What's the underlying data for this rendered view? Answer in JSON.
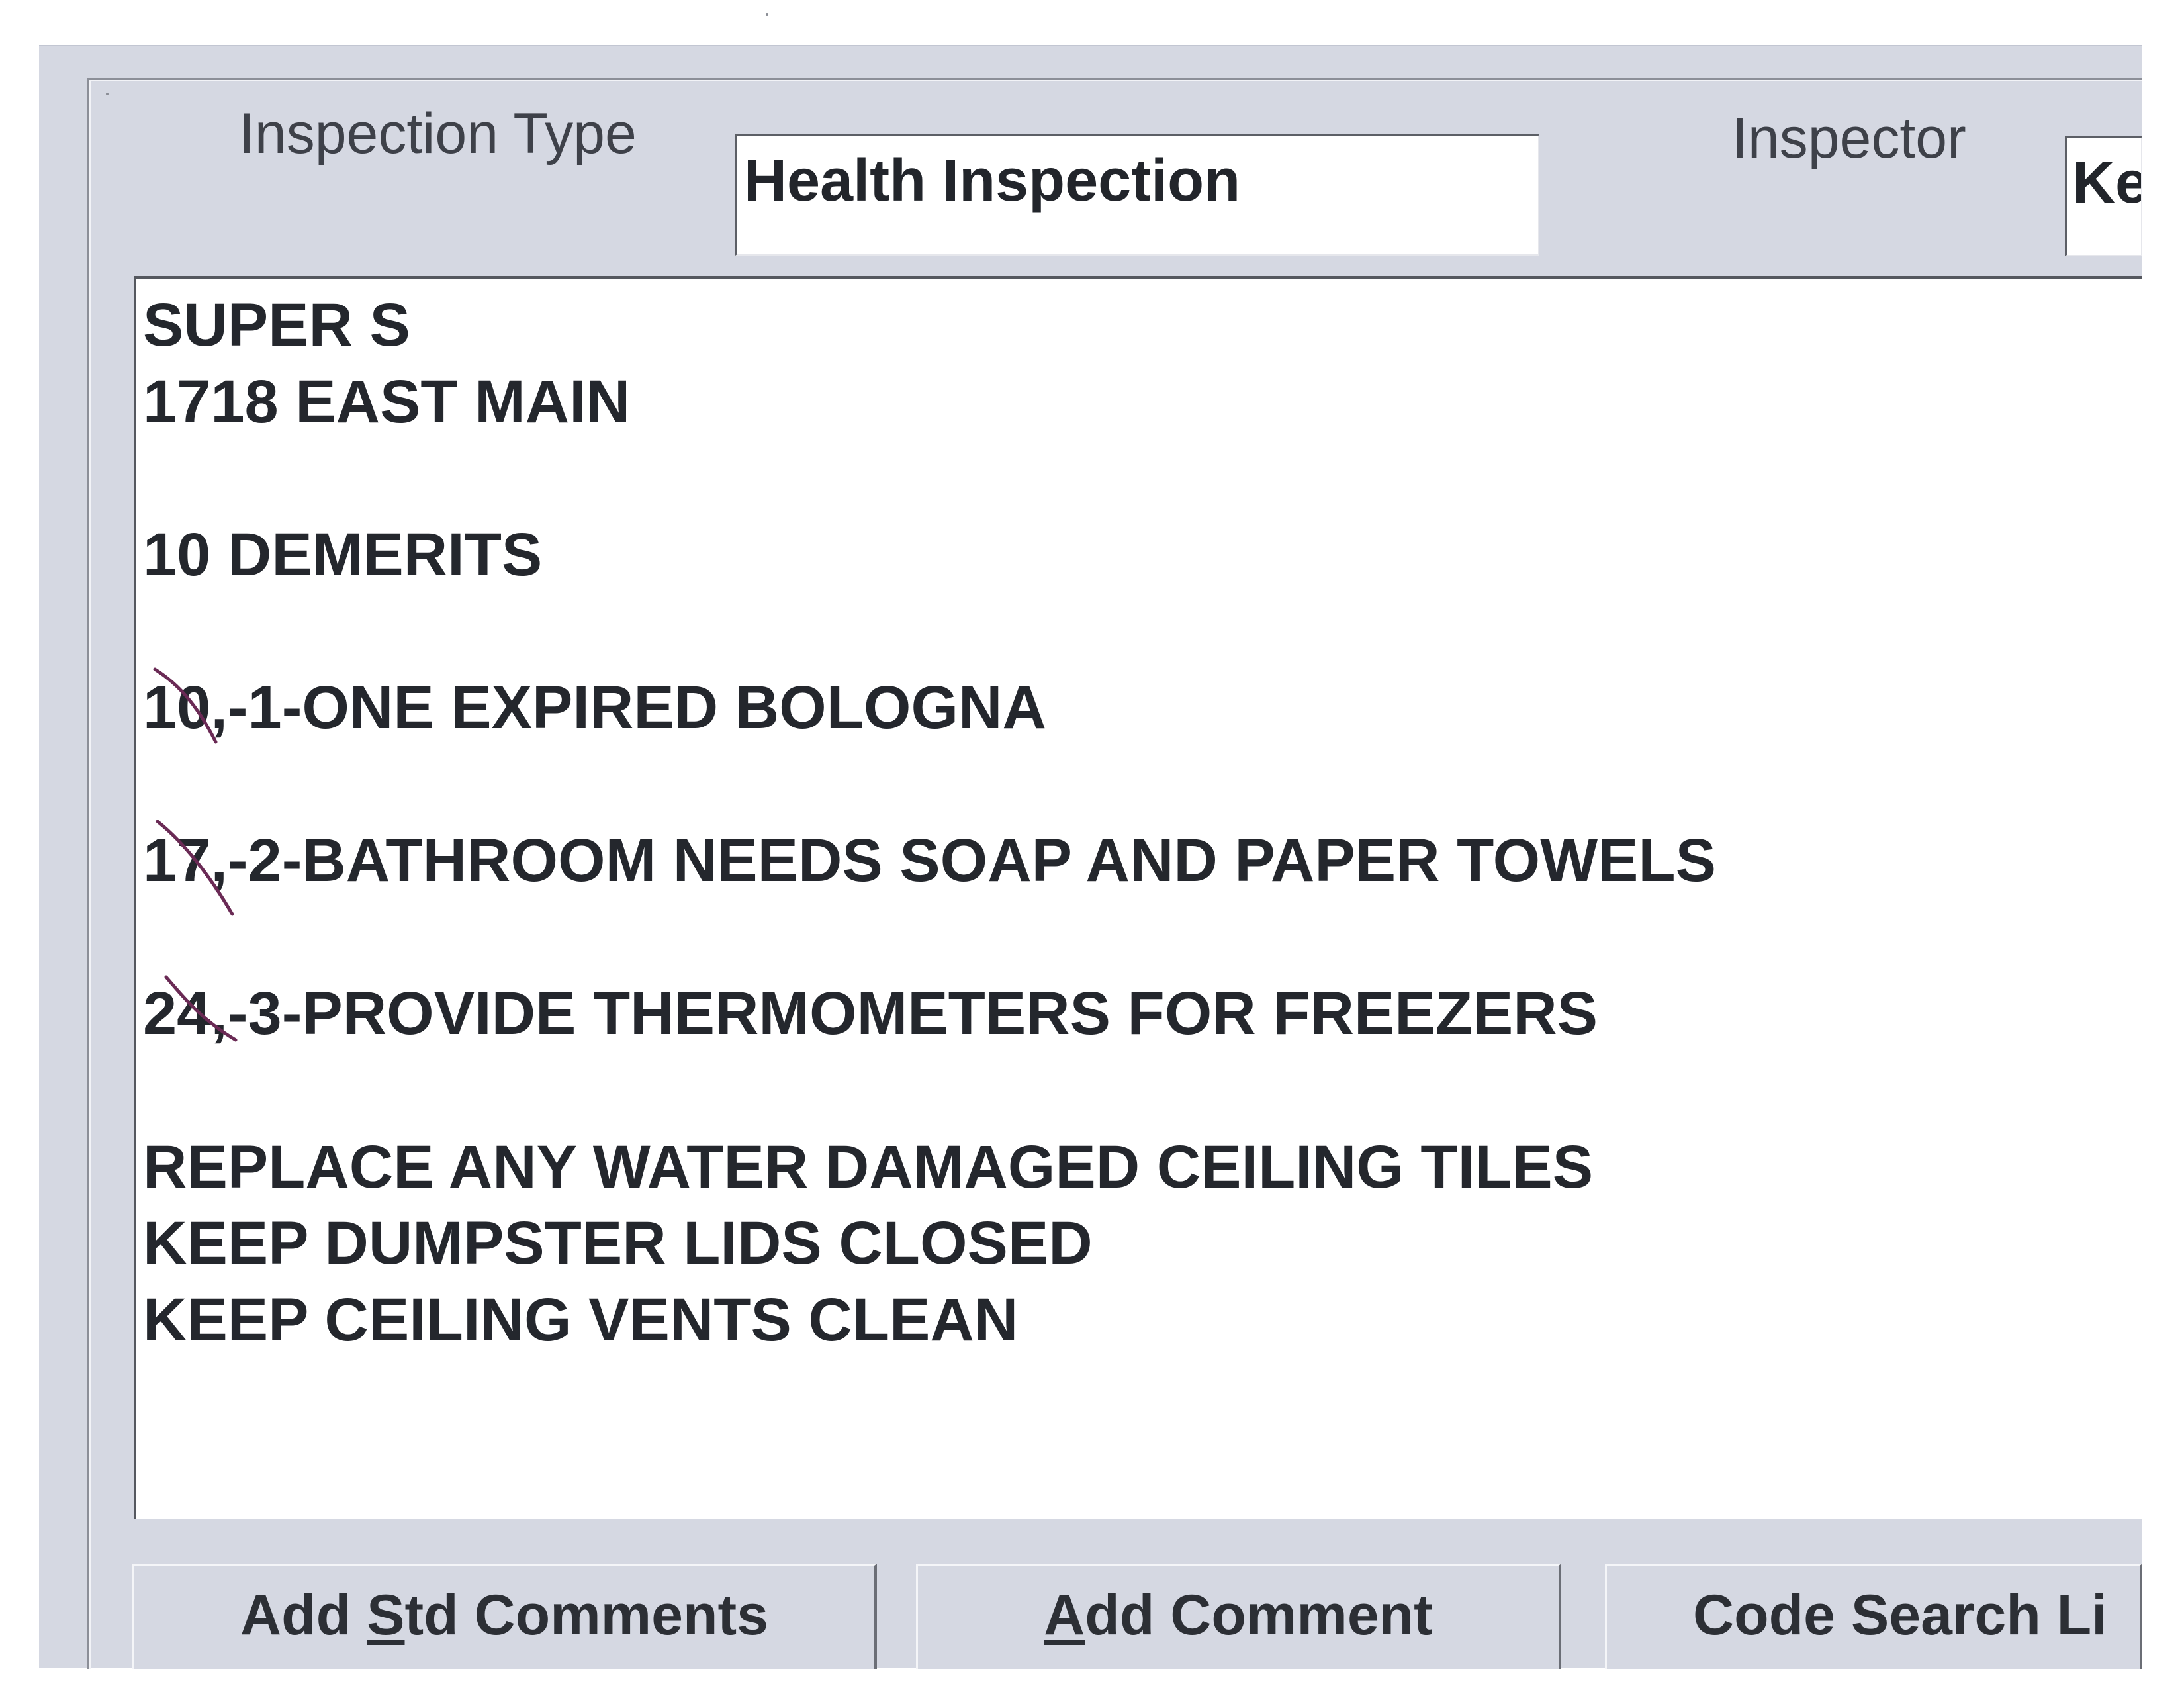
{
  "inspection": {
    "type_label": "Inspection Type",
    "type_value": "Health Inspection",
    "inspector_label": "Inspector",
    "inspector_value": "Ke"
  },
  "comments": {
    "lines": [
      "SUPER S",
      "1718 EAST MAIN",
      "",
      "10 DEMERITS",
      "",
      "10,-1-ONE EXPIRED BOLOGNA",
      "",
      "17,-2-BATHROOM NEEDS SOAP AND PAPER TOWELS",
      "",
      "24,-3-PROVIDE THERMOMETERS FOR FREEZERS",
      "",
      "REPLACE ANY WATER DAMAGED CEILING TILES",
      "KEEP DUMPSTER LIDS CLOSED",
      "KEEP CEILING VENTS CLEAN"
    ]
  },
  "buttons": {
    "std_comments_pre": "Add ",
    "std_comments_mn": "S",
    "std_comments_post": "td Comments",
    "add_comment_mn": "A",
    "add_comment_post": "dd Comment",
    "code_search": "Code Search Li"
  },
  "colors": {
    "panel": "#d5d8e2",
    "field_bg": "#ffffff",
    "text": "#24272d",
    "pen_mark": "#6a2a55"
  }
}
